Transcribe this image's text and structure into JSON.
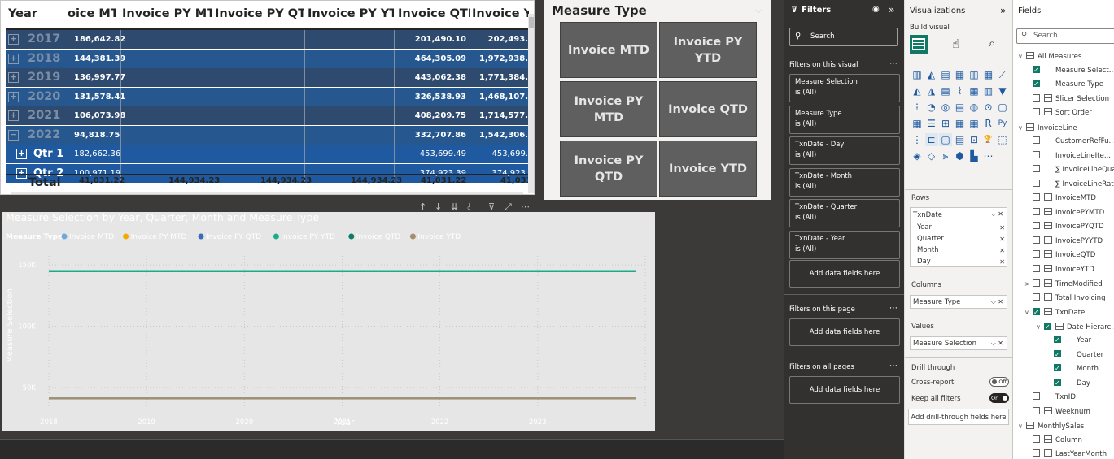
{
  "matrix": {
    "headers": [
      "Year",
      "oice MTD",
      "Invoice PY MTD",
      "Invoice PY QTD",
      "Invoice PY YTD",
      "Invoice QTD",
      "Invoice YT"
    ],
    "rows": [
      {
        "label": "2017",
        "mtd": "186,642.82",
        "qtd": "201,490.10",
        "ytd": "202,493."
      },
      {
        "label": "2018",
        "mtd": "144,381.39",
        "qtd": "464,305.09",
        "ytd": "1,972,938."
      },
      {
        "label": "2019",
        "mtd": "136,997.77",
        "qtd": "443,062.38",
        "ytd": "1,771,384."
      },
      {
        "label": "2020",
        "mtd": "131,578.41",
        "qtd": "326,538.93",
        "ytd": "1,468,107."
      },
      {
        "label": "2021",
        "mtd": "106,073.98",
        "qtd": "408,209.75",
        "ytd": "1,714,577."
      },
      {
        "label": "2022",
        "mtd": "94,818.75",
        "qtd": "332,707.86",
        "ytd": "1,542,306."
      },
      {
        "label": "Qtr 1",
        "mtd": "182,662.36",
        "qtd": "453,699.49",
        "ytd": "453,699."
      },
      {
        "label": "Qtr 2",
        "mtd": "100,971.19",
        "qtd": "374,923.39",
        "ytd": "374,923."
      }
    ],
    "total": {
      "label": "Total",
      "mtd": "41,031.22",
      "py_mtd": "144,934.23",
      "py_qtd": "144,934.23",
      "py_ytd": "144,934.23",
      "qtd": "41,031.22",
      "ytd": "41,031."
    }
  },
  "slicer": {
    "title": "Measure Type",
    "buttons": [
      "Invoice MTD",
      "Invoice PY YTD",
      "Invoice PY MTD",
      "Invoice QTD",
      "Invoice PY QTD",
      "Invoice YTD"
    ]
  },
  "chart_data": {
    "type": "line",
    "title": "Measure Selection by Year, Quarter, Month and Measure Type",
    "xlabel": "Year",
    "ylabel": "Measure Selection",
    "legend_title": "Measure Type",
    "legend_position": "top-left",
    "x": [
      2018,
      2019,
      2020,
      2021,
      2022,
      2023
    ],
    "ylim": [
      30000,
      160000
    ],
    "yticks": [
      {
        "v": 150000,
        "label": "150K"
      },
      {
        "v": 100000,
        "label": "100K"
      },
      {
        "v": 50000,
        "label": "50K"
      }
    ],
    "xlim": [
      2018,
      2024.1
    ],
    "series": [
      {
        "name": "Invoice MTD",
        "color": "#6fa8dc",
        "values": [
          41031,
          41031
        ]
      },
      {
        "name": "Invoice PY MTD",
        "color": "#f2a900",
        "values": [
          41031,
          41031
        ]
      },
      {
        "name": "Invoice PY QTD",
        "color": "#3a6bbf",
        "values": [
          41031,
          41031
        ]
      },
      {
        "name": "Invoice PY YTD",
        "color": "#1aab8a",
        "values": [
          144934,
          144934
        ]
      },
      {
        "name": "Invoice QTD",
        "color": "#0d7c66",
        "values": [
          41031,
          41031
        ]
      },
      {
        "name": "Invoice YTD",
        "color": "#a88d6d",
        "values": [
          41031,
          41031
        ]
      }
    ],
    "series_x": [
      2018,
      2024
    ]
  },
  "filters": {
    "title": "Filters",
    "search": "Search",
    "on_visual": "Filters on this visual",
    "cards": [
      {
        "name": "Measure Selection",
        "state": "is (All)"
      },
      {
        "name": "Measure Type",
        "state": "is (All)"
      },
      {
        "name": "TxnDate - Day",
        "state": "is (All)"
      },
      {
        "name": "TxnDate - Month",
        "state": "is (All)"
      },
      {
        "name": "TxnDate - Quarter",
        "state": "is (All)"
      },
      {
        "name": "TxnDate - Year",
        "state": "is (All)"
      }
    ],
    "add": "Add data fields here",
    "on_page": "Filters on this page",
    "on_all": "Filters on all pages"
  },
  "viz": {
    "title": "Visualizations",
    "build": "Build visual",
    "rows_label": "Rows",
    "rows_field": "TxnDate",
    "rows_items": [
      "Year",
      "Quarter",
      "Month",
      "Day"
    ],
    "columns_label": "Columns",
    "columns_field": "Measure Type",
    "values_label": "Values",
    "values_field": "Measure Selection",
    "drill": "Drill through",
    "cross": "Cross-report",
    "cross_state": "Off",
    "keep": "Keep all filters",
    "keep_state": "On",
    "add_drill": "Add drill-through fields here"
  },
  "fields": {
    "title": "Fields",
    "search": "Search",
    "items": [
      {
        "t": "All Measures",
        "lvl": 0,
        "kind": "table",
        "chev": "∨"
      },
      {
        "t": "Measure Select...",
        "lvl": 1,
        "kind": "check",
        "on": true
      },
      {
        "t": "Measure Type",
        "lvl": 1,
        "kind": "check",
        "on": true
      },
      {
        "t": "Slicer Selection",
        "lvl": 1,
        "kind": "field",
        "on": false
      },
      {
        "t": "Sort Order",
        "lvl": 1,
        "kind": "field",
        "on": false
      },
      {
        "t": "InvoiceLine",
        "lvl": 0,
        "kind": "table",
        "chev": "∨"
      },
      {
        "t": "CustomerRefFu...",
        "lvl": 1,
        "kind": "check",
        "on": false
      },
      {
        "t": "InvoiceLineIte...",
        "lvl": 1,
        "kind": "check",
        "on": false
      },
      {
        "t": "∑ InvoiceLineQua...",
        "lvl": 1,
        "kind": "check",
        "on": false
      },
      {
        "t": "∑ InvoiceLineRate",
        "lvl": 1,
        "kind": "check",
        "on": false
      },
      {
        "t": "InvoiceMTD",
        "lvl": 1,
        "kind": "field",
        "on": false
      },
      {
        "t": "InvoicePYMTD",
        "lvl": 1,
        "kind": "field",
        "on": false
      },
      {
        "t": "InvoicePYQTD",
        "lvl": 1,
        "kind": "field",
        "on": false
      },
      {
        "t": "InvoicePYYTD",
        "lvl": 1,
        "kind": "field",
        "on": false
      },
      {
        "t": "InvoiceQTD",
        "lvl": 1,
        "kind": "field",
        "on": false
      },
      {
        "t": "InvoiceYTD",
        "lvl": 1,
        "kind": "field",
        "on": false
      },
      {
        "t": "TimeModified",
        "lvl": 1,
        "kind": "field",
        "on": false,
        "chev": ">"
      },
      {
        "t": "Total Invoicing",
        "lvl": 1,
        "kind": "field",
        "on": false
      },
      {
        "t": "TxnDate",
        "lvl": 1,
        "kind": "field",
        "on": true,
        "chev": "∨"
      },
      {
        "t": "Date Hierarc...",
        "lvl": 2,
        "kind": "field",
        "on": true,
        "chev": "∨"
      },
      {
        "t": "Year",
        "lvl": 3,
        "kind": "check",
        "on": true
      },
      {
        "t": "Quarter",
        "lvl": 3,
        "kind": "check",
        "on": true
      },
      {
        "t": "Month",
        "lvl": 3,
        "kind": "check",
        "on": true
      },
      {
        "t": "Day",
        "lvl": 3,
        "kind": "check",
        "on": true
      },
      {
        "t": "TxnID",
        "lvl": 1,
        "kind": "check",
        "on": false
      },
      {
        "t": "Weeknum",
        "lvl": 1,
        "kind": "field",
        "on": false
      },
      {
        "t": "MonthlySales",
        "lvl": 0,
        "kind": "table",
        "chev": "∨"
      },
      {
        "t": "Column",
        "lvl": 1,
        "kind": "field",
        "on": false
      },
      {
        "t": "LastYearMonth",
        "lvl": 1,
        "kind": "field",
        "on": false
      }
    ]
  }
}
